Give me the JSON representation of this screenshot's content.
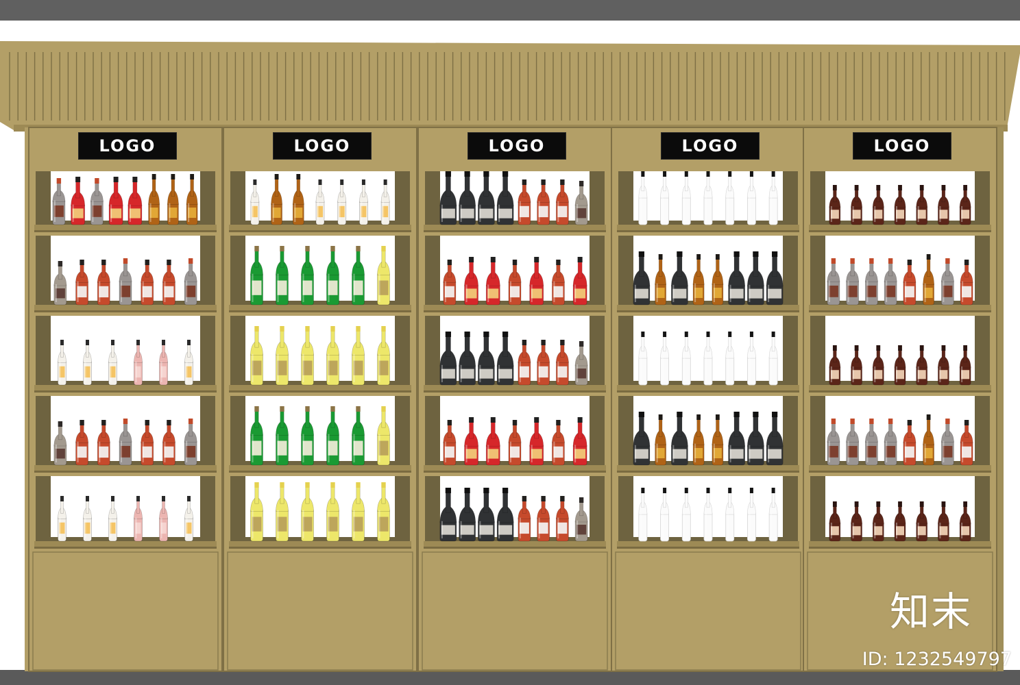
{
  "scene": {
    "description_free": true,
    "colors": {
      "top_band": "#606060",
      "wall": "#ffffff",
      "cabinet": "#b39f67",
      "cabinet_dark": "#9d8a55",
      "cabinet_side": "#84744a",
      "shelf_shadow": "#6e6340",
      "sign_bg": "#0b0b0b",
      "sign_text": "#ffffff"
    }
  },
  "units": [
    {
      "logo": "LOGO"
    },
    {
      "logo": "LOGO"
    },
    {
      "logo": "LOGO"
    },
    {
      "logo": "LOGO"
    },
    {
      "logo": "LOGO"
    }
  ],
  "shelves": {
    "patterns": {
      "A": [
        "rum",
        "jager",
        "jager",
        "silver",
        "jager",
        "jager",
        "silver"
      ],
      "B": [
        "clear",
        "clear",
        "clear",
        "pink",
        "pink",
        "clear"
      ],
      "C": [
        "dark",
        "dark",
        "dark",
        "dark",
        "jager",
        "jager",
        "jager",
        "rum"
      ],
      "D": [
        "green",
        "green",
        "green",
        "green",
        "green",
        "yellow"
      ],
      "E": [
        "yellow",
        "yellow",
        "yellow",
        "yellow",
        "yellow",
        "yellow"
      ],
      "F": [
        "clear",
        "amber",
        "amber",
        "clear",
        "clear",
        "clear",
        "clear"
      ],
      "G": [
        "silver",
        "red",
        "silver",
        "red",
        "red",
        "amber",
        "amber",
        "amber"
      ],
      "H": [
        "jager",
        "red",
        "red",
        "jager",
        "red",
        "jager",
        "red"
      ],
      "I": [
        "glass",
        "glass",
        "glass",
        "glass",
        "glass",
        "glass",
        "glass"
      ],
      "J": [
        "dark",
        "amber",
        "dark",
        "amber",
        "amber",
        "dark",
        "dark",
        "dark"
      ],
      "K": [
        "brown",
        "brown",
        "brown",
        "brown",
        "brown",
        "brown",
        "brown"
      ],
      "L": [
        "silver",
        "silver",
        "silver",
        "silver",
        "jager",
        "amber",
        "silver",
        "jager"
      ]
    },
    "layout": [
      [
        "G",
        "F",
        "C",
        "I",
        "K"
      ],
      [
        "A",
        "D",
        "H",
        "J",
        "L"
      ],
      [
        "B",
        "E",
        "C",
        "I",
        "K"
      ],
      [
        "A",
        "D",
        "H",
        "J",
        "L"
      ],
      [
        "B",
        "E",
        "C",
        "I",
        "K"
      ]
    ]
  },
  "watermark": {
    "brand": "知末",
    "id_text": "ID: 1232549797"
  }
}
